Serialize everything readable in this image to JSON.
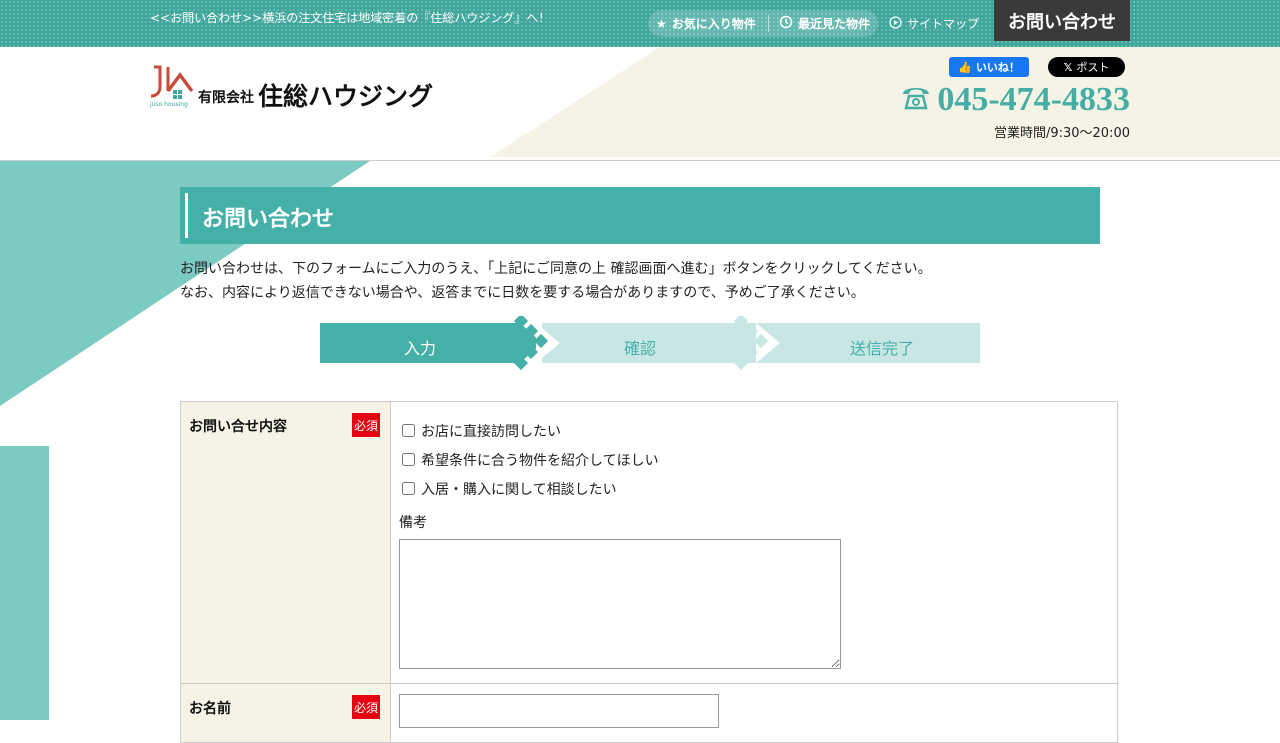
{
  "topbar": {
    "tagline": "<<お問い合わせ>>横浜の注文住宅は地域密着の『住総ハウジング』へ！",
    "favorites": "お気に入り物件",
    "recent": "最近見た物件",
    "sitemap": "サイトマップ",
    "contact": "お問い合わせ"
  },
  "header": {
    "logo_mark": "juso housing",
    "company_prefix": "有限会社",
    "company_name": "住総ハウジング",
    "fb_like": "いいね！",
    "x_post": "ポスト",
    "phone": "045-474-4833",
    "hours": "営業時間/9:30～20:00"
  },
  "page": {
    "title": "お問い合わせ",
    "intro_line1": "お問い合わせは、下のフォームにご入力のうえ、「上記にご同意の上 確認画面へ進む」ボタンをクリックしてください。",
    "intro_line2": "なお、内容により返信できない場合や、返答までに日数を要する場合がありますので、予めご了承ください。"
  },
  "steps": [
    "入力",
    "確認",
    "送信完了"
  ],
  "form": {
    "required_badge": "必須",
    "inquiry": {
      "label": "お問い合せ内容",
      "options": [
        "お店に直接訪問したい",
        "希望条件に合う物件を紹介してほしい",
        "入居・購入に関して相談したい"
      ],
      "note_label": "備考"
    },
    "name": {
      "label": "お名前"
    }
  },
  "colors": {
    "teal": "#45b0a7",
    "teal_light": "#c8e6e4",
    "teal_bg": "#7ccbc2",
    "cream": "#f4f3e6",
    "required_red": "#e50012"
  }
}
